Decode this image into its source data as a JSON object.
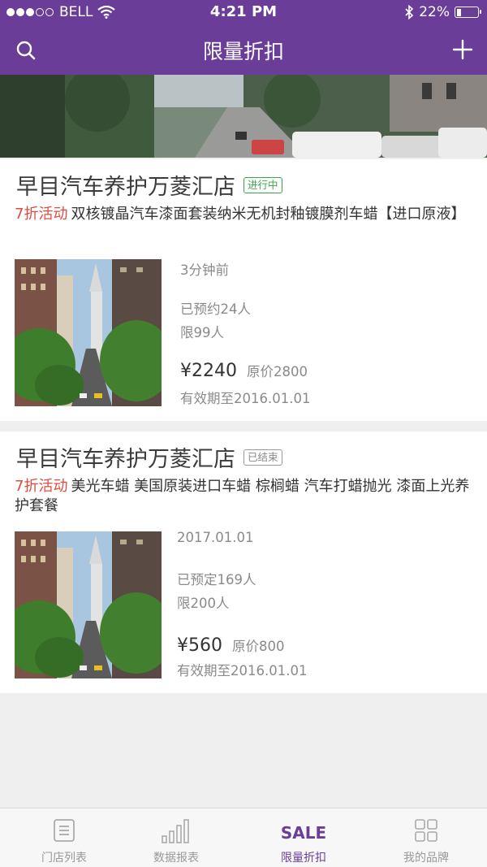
{
  "status_bar": {
    "carrier": "BELL",
    "time": "4:21 PM",
    "battery": "22%",
    "battery_level": 0.22
  },
  "nav": {
    "title": "限量折扣",
    "left_icon": "search-icon",
    "right_icon": "plus-icon"
  },
  "deals": [
    {
      "shop": "早目汽车养护万菱汇店",
      "status": "进行中",
      "promo": "7折活动",
      "title": "双核镀晶汽车漆面套装纳米无机封釉镀膜剂车蜡【进口原液】",
      "time": "3分钟前",
      "booked": "已预约24人",
      "limit": "限99人",
      "price": "¥2240",
      "original_price": "原价2800",
      "valid": "有效期至2016.01.01"
    },
    {
      "shop": "早目汽车养护万菱汇店",
      "status": "已结束",
      "promo": "7折活动",
      "title": "美光车蜡 美国原装进口车蜡 棕榈蜡 汽车打蜡抛光 漆面上光养护套餐",
      "time": "2017.01.01",
      "booked": "已预定169人",
      "limit": "限200人",
      "price": "¥560",
      "original_price": "原价800",
      "valid": "有效期至2016.01.01"
    }
  ],
  "tabs": [
    {
      "label": "门店列表",
      "icon": "store-list-icon"
    },
    {
      "label": "数据报表",
      "icon": "bar-chart-icon"
    },
    {
      "label": "限量折扣",
      "icon_text": "SALE"
    },
    {
      "label": "我的品牌",
      "icon": "grid-icon"
    }
  ],
  "colors": {
    "primary": "#6a3d99",
    "promo": "#e14b3e",
    "active_tag": "#3aa64a"
  }
}
